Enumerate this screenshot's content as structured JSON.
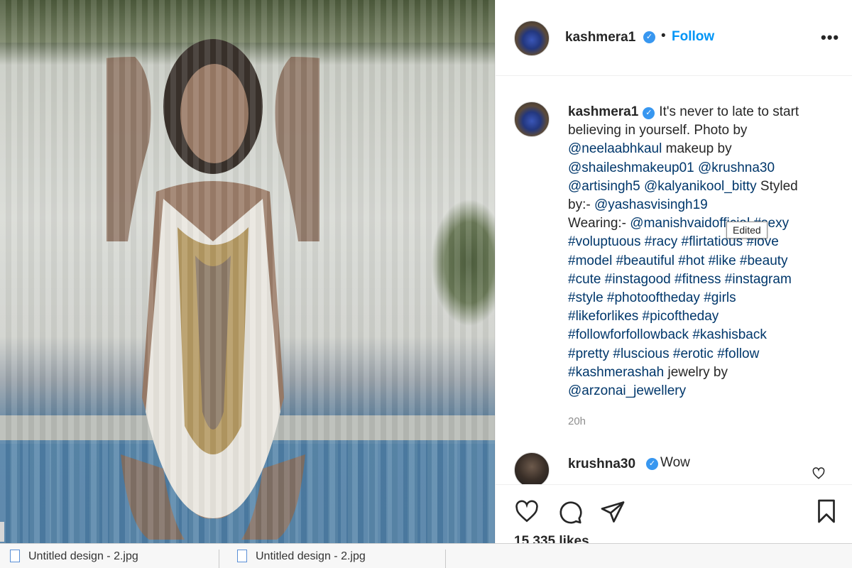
{
  "post": {
    "username": "kashmera1",
    "verified": true,
    "follow_label": "Follow",
    "dot": "•",
    "more_label": "•••"
  },
  "caption": {
    "username": "kashmera1",
    "lines": [
      [
        {
          "t": "It's never to late to start",
          "tag": false
        }
      ],
      [
        {
          "t": "believing in yourself. Photo by",
          "tag": false
        }
      ],
      [
        {
          "t": "@neelaabhkaul",
          "tag": true
        },
        {
          "t": " makeup by",
          "tag": false
        }
      ],
      [
        {
          "t": "@shaileshmakeup01",
          "tag": true
        },
        {
          "t": " ",
          "tag": false
        },
        {
          "t": "@krushna30",
          "tag": true
        }
      ],
      [
        {
          "t": "@artisingh5",
          "tag": true
        },
        {
          "t": " ",
          "tag": false
        },
        {
          "t": "@kalyanikool_bitty",
          "tag": true
        },
        {
          "t": " Styled",
          "tag": false
        }
      ],
      [
        {
          "t": "by:- ",
          "tag": false
        },
        {
          "t": "@yashasvisingh19",
          "tag": true
        }
      ],
      [
        {
          "t": "Wearing:- ",
          "tag": false
        },
        {
          "t": "@manishvaidofficial",
          "tag": true
        },
        {
          "t": " ",
          "tag": false
        },
        {
          "t": "#sexy",
          "tag": true
        }
      ],
      [
        {
          "t": "#voluptuous",
          "tag": true
        },
        {
          "t": " ",
          "tag": false
        },
        {
          "t": "#racy",
          "tag": true
        },
        {
          "t": " ",
          "tag": false
        },
        {
          "t": "#flirtatious",
          "tag": true
        },
        {
          "t": " ",
          "tag": false
        },
        {
          "t": "#love",
          "tag": true
        }
      ],
      [
        {
          "t": "#model",
          "tag": true
        },
        {
          "t": " ",
          "tag": false
        },
        {
          "t": "#beautiful",
          "tag": true
        },
        {
          "t": " ",
          "tag": false
        },
        {
          "t": "#hot",
          "tag": true
        },
        {
          "t": " ",
          "tag": false
        },
        {
          "t": "#like",
          "tag": true
        },
        {
          "t": " ",
          "tag": false
        },
        {
          "t": "#beauty",
          "tag": true
        }
      ],
      [
        {
          "t": "#cute",
          "tag": true
        },
        {
          "t": " ",
          "tag": false
        },
        {
          "t": "#instagood",
          "tag": true
        },
        {
          "t": " ",
          "tag": false
        },
        {
          "t": "#fitness",
          "tag": true
        },
        {
          "t": " ",
          "tag": false
        },
        {
          "t": "#instagram",
          "tag": true
        }
      ],
      [
        {
          "t": "#style",
          "tag": true
        },
        {
          "t": " ",
          "tag": false
        },
        {
          "t": "#photooftheday",
          "tag": true
        },
        {
          "t": " ",
          "tag": false
        },
        {
          "t": "#girls",
          "tag": true
        }
      ],
      [
        {
          "t": "#likeforlikes",
          "tag": true
        },
        {
          "t": " ",
          "tag": false
        },
        {
          "t": "#picoftheday",
          "tag": true
        }
      ],
      [
        {
          "t": "#followforfollowback",
          "tag": true
        },
        {
          "t": " ",
          "tag": false
        },
        {
          "t": "#kashisback",
          "tag": true
        }
      ],
      [
        {
          "t": "#pretty",
          "tag": true
        },
        {
          "t": " ",
          "tag": false
        },
        {
          "t": "#luscious",
          "tag": true
        },
        {
          "t": " ",
          "tag": false
        },
        {
          "t": "#erotic",
          "tag": true
        },
        {
          "t": " ",
          "tag": false
        },
        {
          "t": "#follow",
          "tag": true
        }
      ],
      [
        {
          "t": "#kashmerashah",
          "tag": true
        },
        {
          "t": " jewelry by",
          "tag": false
        }
      ],
      [
        {
          "t": "@arzonai_jewellery",
          "tag": true
        }
      ]
    ],
    "tooltip": "Edited",
    "time": "20h"
  },
  "comment": {
    "username": "krushna30",
    "text": "Wow"
  },
  "actions": {
    "likes": "15,335 likes"
  },
  "downloads": [
    {
      "label": "Untitled design - 2.jpg"
    },
    {
      "label": "Untitled design - 2.jpg"
    }
  ],
  "colors": {
    "link": "#0095f6",
    "tag": "#00376b",
    "verified": "#3897f0",
    "muted": "#8e8e8e"
  }
}
